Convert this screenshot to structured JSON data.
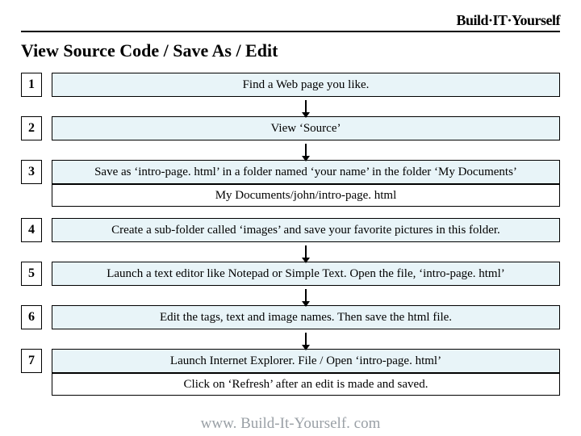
{
  "logo": {
    "text": "Build·IT·Yourself"
  },
  "title": "View Source Code / Save As / Edit",
  "steps": [
    {
      "n": "1",
      "text": "Find a Web page you like."
    },
    {
      "n": "2",
      "text": "View ‘Source’"
    },
    {
      "n": "3",
      "text": "Save as ‘intro-page. html’ in a folder named ‘your name’ in the folder ‘My Documents’",
      "sub": "My Documents/john/intro-page. html"
    },
    {
      "n": "4",
      "text": "Create a sub-folder called ‘images’ and save your favorite pictures in this folder."
    },
    {
      "n": "5",
      "text": "Launch a text editor like Notepad or Simple Text.  Open the file, ‘intro-page. html’"
    },
    {
      "n": "6",
      "text": "Edit the tags, text and image names.  Then save the html file."
    },
    {
      "n": "7",
      "text": "Launch Internet Explorer.  File / Open ‘intro-page. html’",
      "extra": "Click on ‘Refresh’ after an edit is made and saved."
    }
  ],
  "footer": "www. Build-It-Yourself. com"
}
